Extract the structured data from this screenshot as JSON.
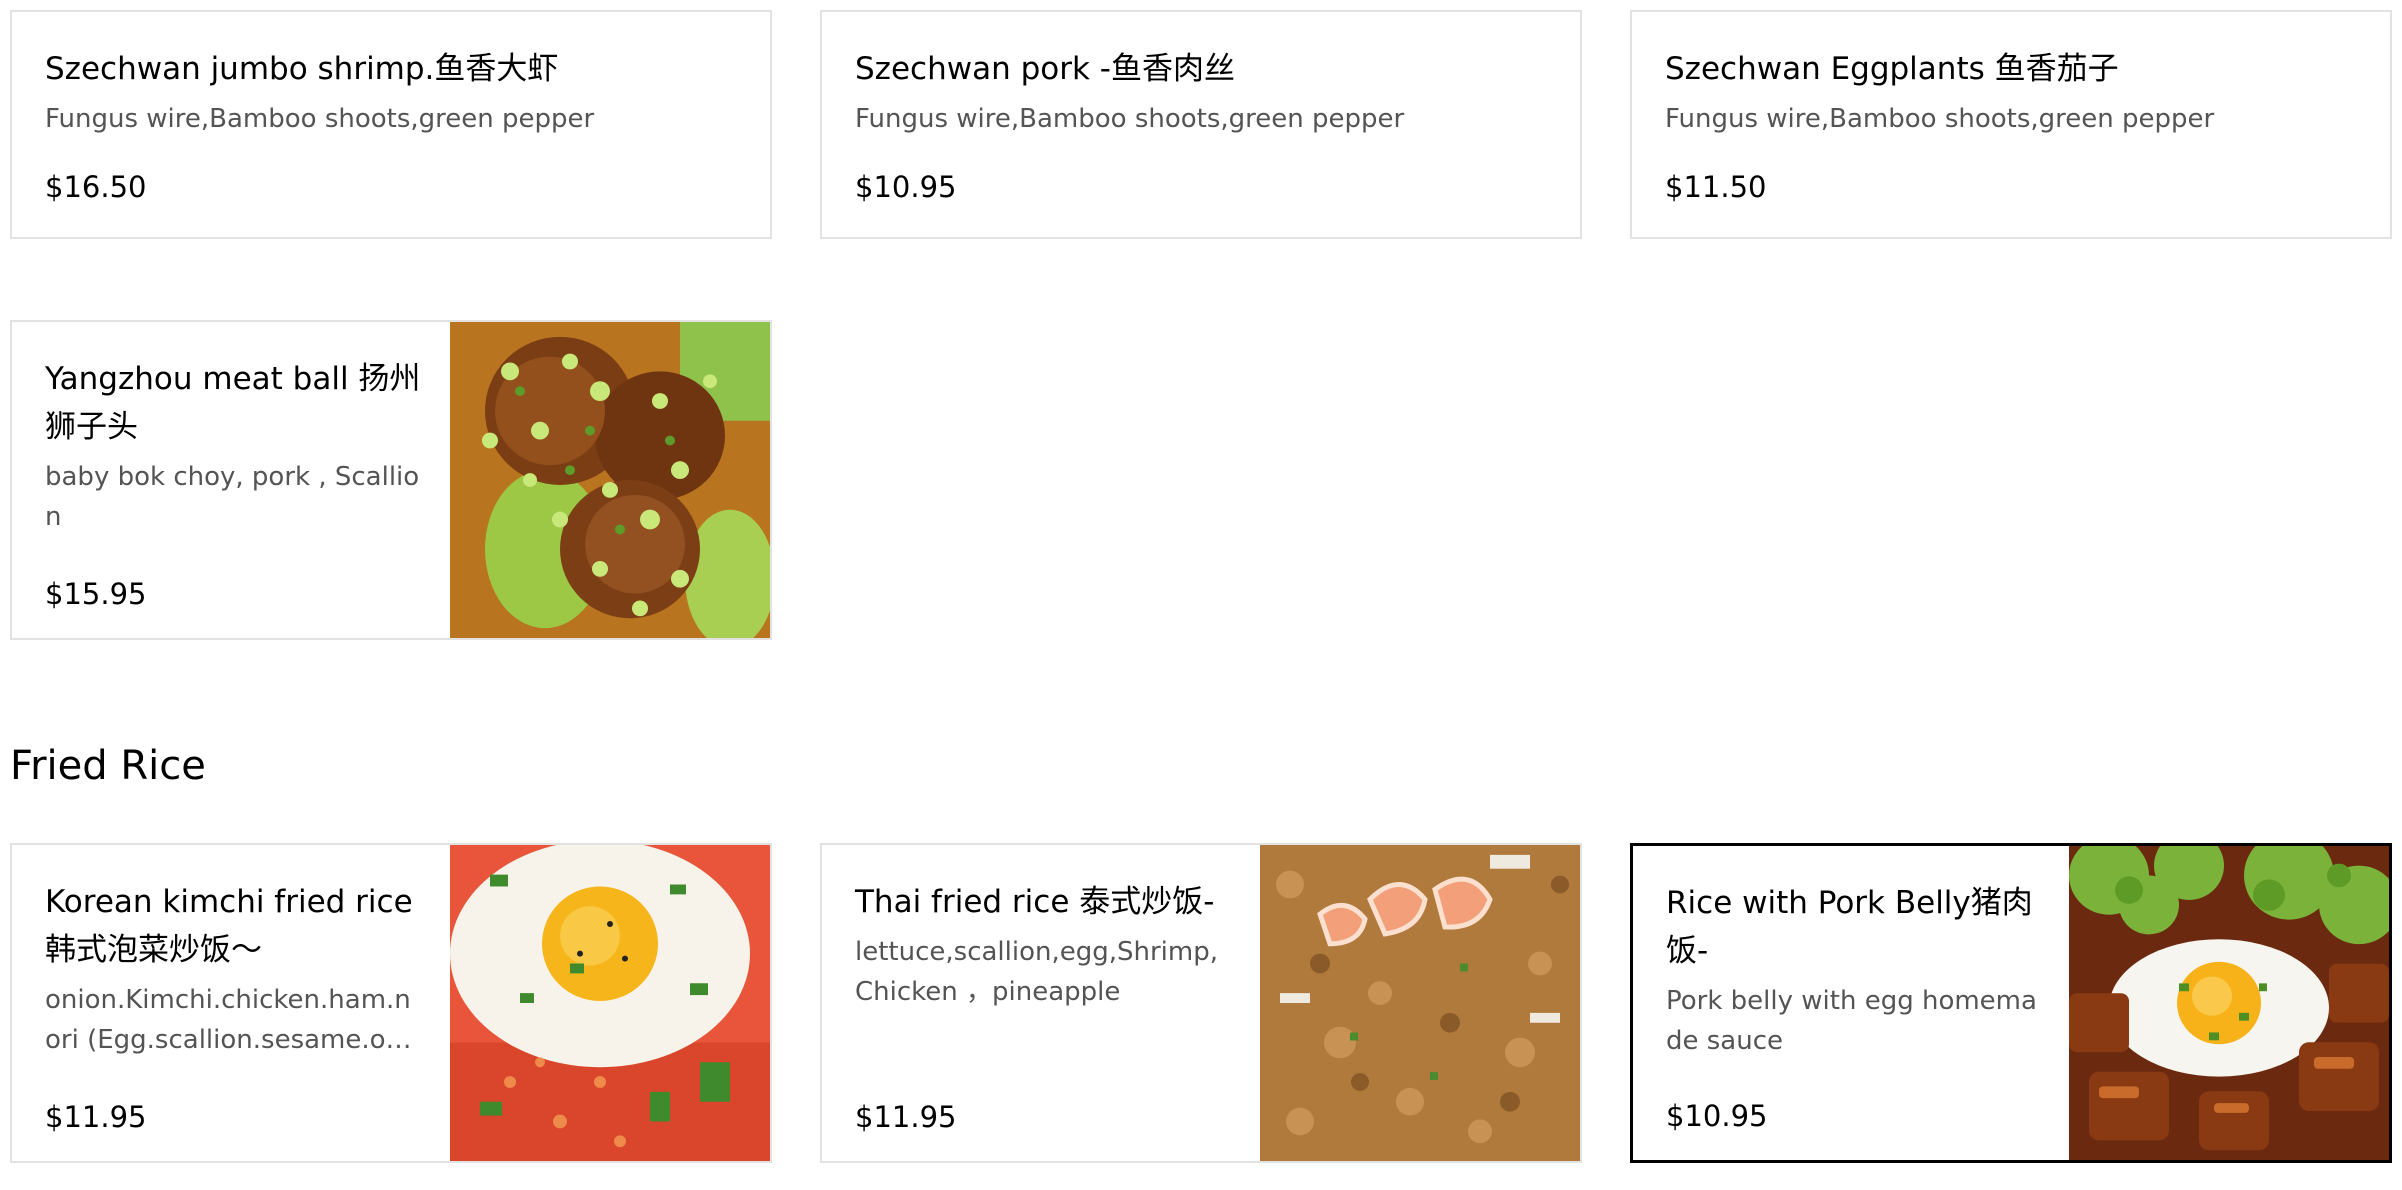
{
  "top_row": [
    {
      "title": "Szechwan jumbo shrimp.鱼香大虾",
      "description": "Fungus wire,Bamboo shoots,green pepper",
      "price": "$16.50"
    },
    {
      "title": "Szechwan pork -鱼香肉丝",
      "description": "Fungus wire,Bamboo shoots,green pepper",
      "price": "$10.95"
    },
    {
      "title": "Szechwan Eggplants 鱼香茄子",
      "description": "Fungus wire,Bamboo shoots,green pepper",
      "price": "$11.50"
    }
  ],
  "meatball": {
    "title": "Yangzhou meat ball 扬州狮子头",
    "description": "baby bok choy, pork , Scallion",
    "price": "$15.95",
    "image_icon": "meatball-photo"
  },
  "fried_rice": {
    "section_title": "Fried Rice",
    "items": [
      {
        "title": "Korean kimchi fried rice 韩式泡菜炒饭～",
        "description": "onion.Kimchi.chicken.ham.nori (Egg.scallion.sesame.on...",
        "price": "$11.95",
        "image_icon": "kimchi-fried-rice-photo"
      },
      {
        "title": "Thai fried rice 泰式炒饭-",
        "description": "lettuce,scallion,egg,Shrimp,Chicken ，pineapple",
        "price": "$11.95",
        "image_icon": "thai-fried-rice-photo"
      },
      {
        "title": "Rice with Pork Belly猪肉饭-",
        "description": "Pork belly with egg homemade sauce",
        "price": "$10.95",
        "image_icon": "pork-belly-rice-photo"
      }
    ]
  },
  "colors": {
    "card_border": "#e2e2e2",
    "selected_border": "#000000",
    "description_text": "#545454"
  }
}
